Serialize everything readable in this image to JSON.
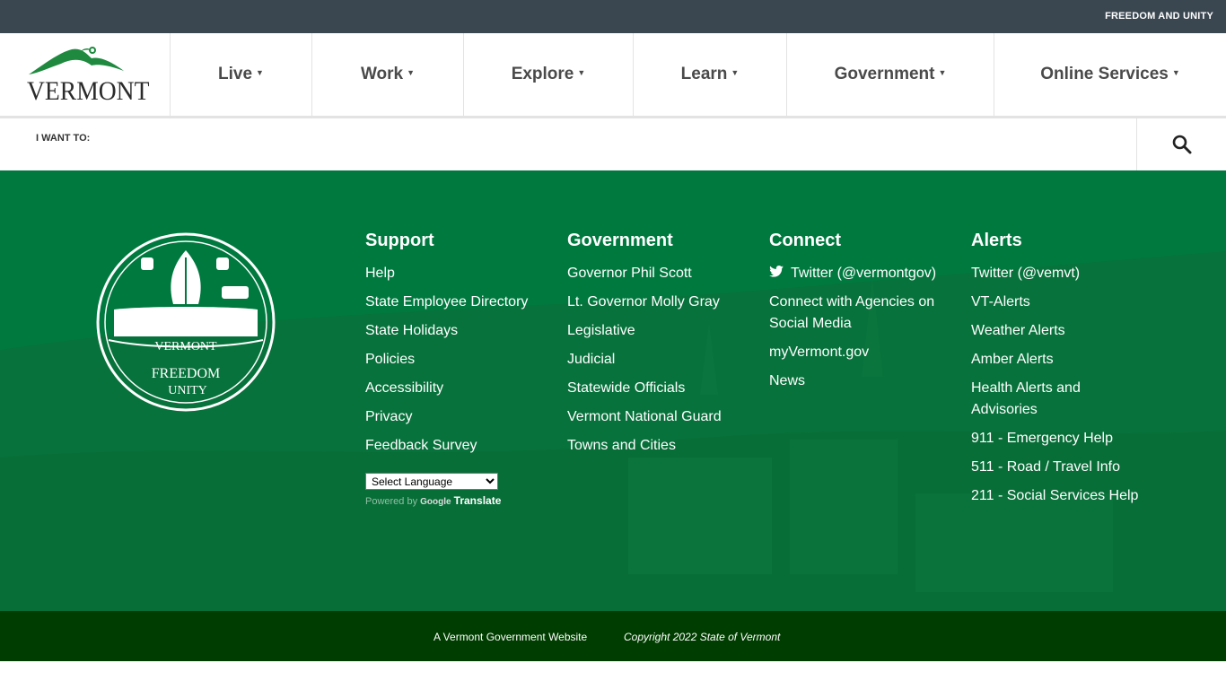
{
  "topbar": {
    "tagline": "FREEDOM AND UNITY"
  },
  "logo": {
    "wordmark": "VERMONT"
  },
  "nav": {
    "items": [
      {
        "label": "Live"
      },
      {
        "label": "Work"
      },
      {
        "label": "Explore"
      },
      {
        "label": "Learn"
      },
      {
        "label": "Government"
      },
      {
        "label": "Online Services"
      }
    ],
    "caret": "▼"
  },
  "iwant": {
    "label": "I WANT TO:"
  },
  "icons": {
    "search": "search-icon",
    "twitter": "twitter-icon",
    "caret": "caret-down-icon"
  },
  "colors": {
    "topbar": "#3a4650",
    "footer": "#00793f",
    "bottombar": "#003d00",
    "logo_green": "#1f8a3f"
  },
  "seal": {
    "top": "VERMONT",
    "motto_line1": "FREEDOM",
    "motto_line2": "UNITY"
  },
  "footer": {
    "support": {
      "heading": "Support",
      "links": [
        "Help",
        "State Employee Directory",
        "State Holidays",
        "Policies",
        "Accessibility",
        "Privacy",
        "Feedback Survey"
      ]
    },
    "government": {
      "heading": "Government",
      "links": [
        "Governor Phil Scott",
        "Lt. Governor Molly Gray",
        "Legislative",
        "Judicial",
        "Statewide Officials",
        "Vermont National Guard",
        "Towns and Cities"
      ]
    },
    "connect": {
      "heading": "Connect",
      "twitter": "Twitter (@vermontgov)",
      "links": [
        "Connect with Agencies on Social Media",
        "myVermont.gov",
        "News"
      ]
    },
    "alerts": {
      "heading": "Alerts",
      "links": [
        "Twitter (@vemvt)",
        "VT-Alerts",
        "Weather Alerts",
        "Amber Alerts",
        "Health Alerts and Advisories",
        "911 - Emergency Help",
        "511 - Road / Travel Info",
        "211 - Social Services Help"
      ]
    },
    "translate": {
      "select_value": "Select Language",
      "powered_by": "Powered by",
      "google": "Google",
      "translate": "Translate"
    }
  },
  "bottombar": {
    "left": "A Vermont Government Website",
    "right": "Copyright 2022 State of Vermont"
  }
}
